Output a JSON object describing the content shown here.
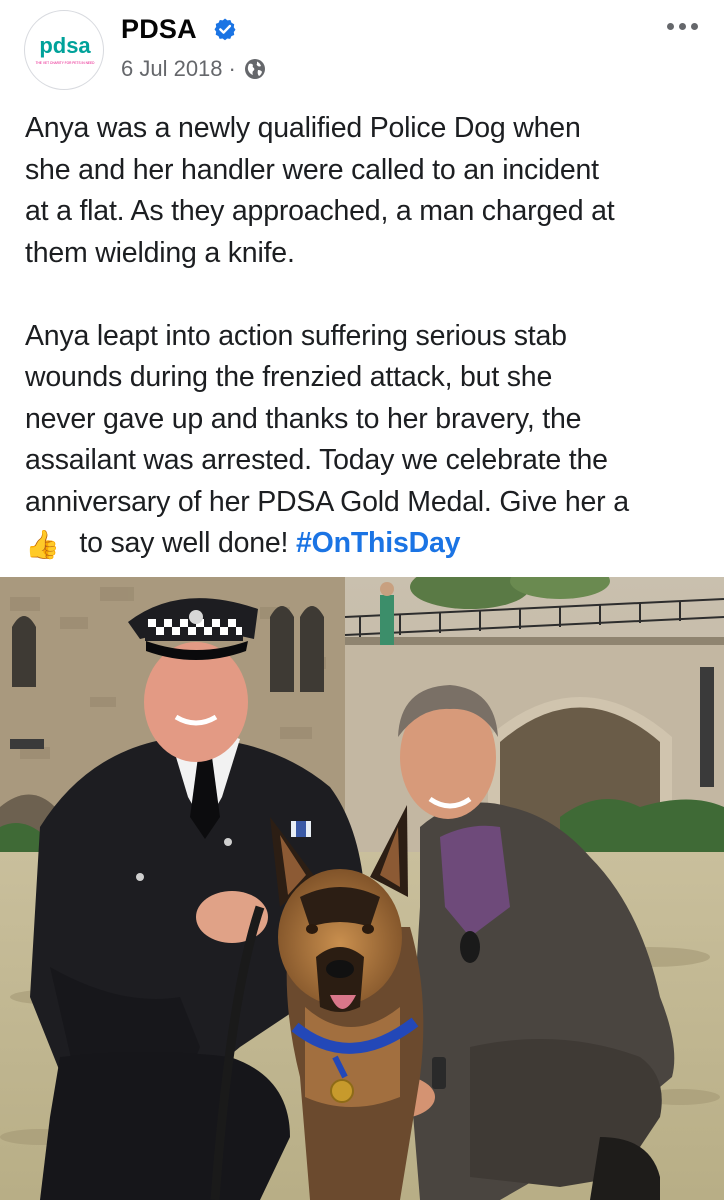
{
  "post": {
    "page_name": "PDSA",
    "verified_icon": "verified-badge-icon",
    "date": "6 Jul 2018",
    "separator": "·",
    "audience_icon": "globe-icon",
    "more_icon": "more-options-icon",
    "logo": {
      "wordmark": "pdsa",
      "tagline": "THE VET CHARITY FOR PETS IN NEED"
    },
    "text": {
      "paragraph1_lines": [
        "Anya was a newly qualified Police Dog when",
        "she and her handler were called to an incident",
        "at a flat. As they approached, a man charged at",
        "them wielding a knife."
      ],
      "paragraph2_lines": [
        "Anya leapt into action suffering serious stab",
        "wounds during the frenzied attack, but she",
        "never gave up and thanks to her bravery, the",
        "assailant was arrested. Today we celebrate the",
        "anniversary of her PDSA Gold Medal. Give her a"
      ],
      "last_line_emoji": "👍",
      "last_line_text": " to say well done! ",
      "hashtag": "#OnThisDay"
    },
    "photo_icon": "post-photo-image"
  },
  "colors": {
    "brand_teal": "#00a29a",
    "brand_pink": "#e6007e",
    "verified_blue": "#1b74e4",
    "hashtag_blue": "#1b74e4",
    "meta_gray": "#65676b"
  }
}
